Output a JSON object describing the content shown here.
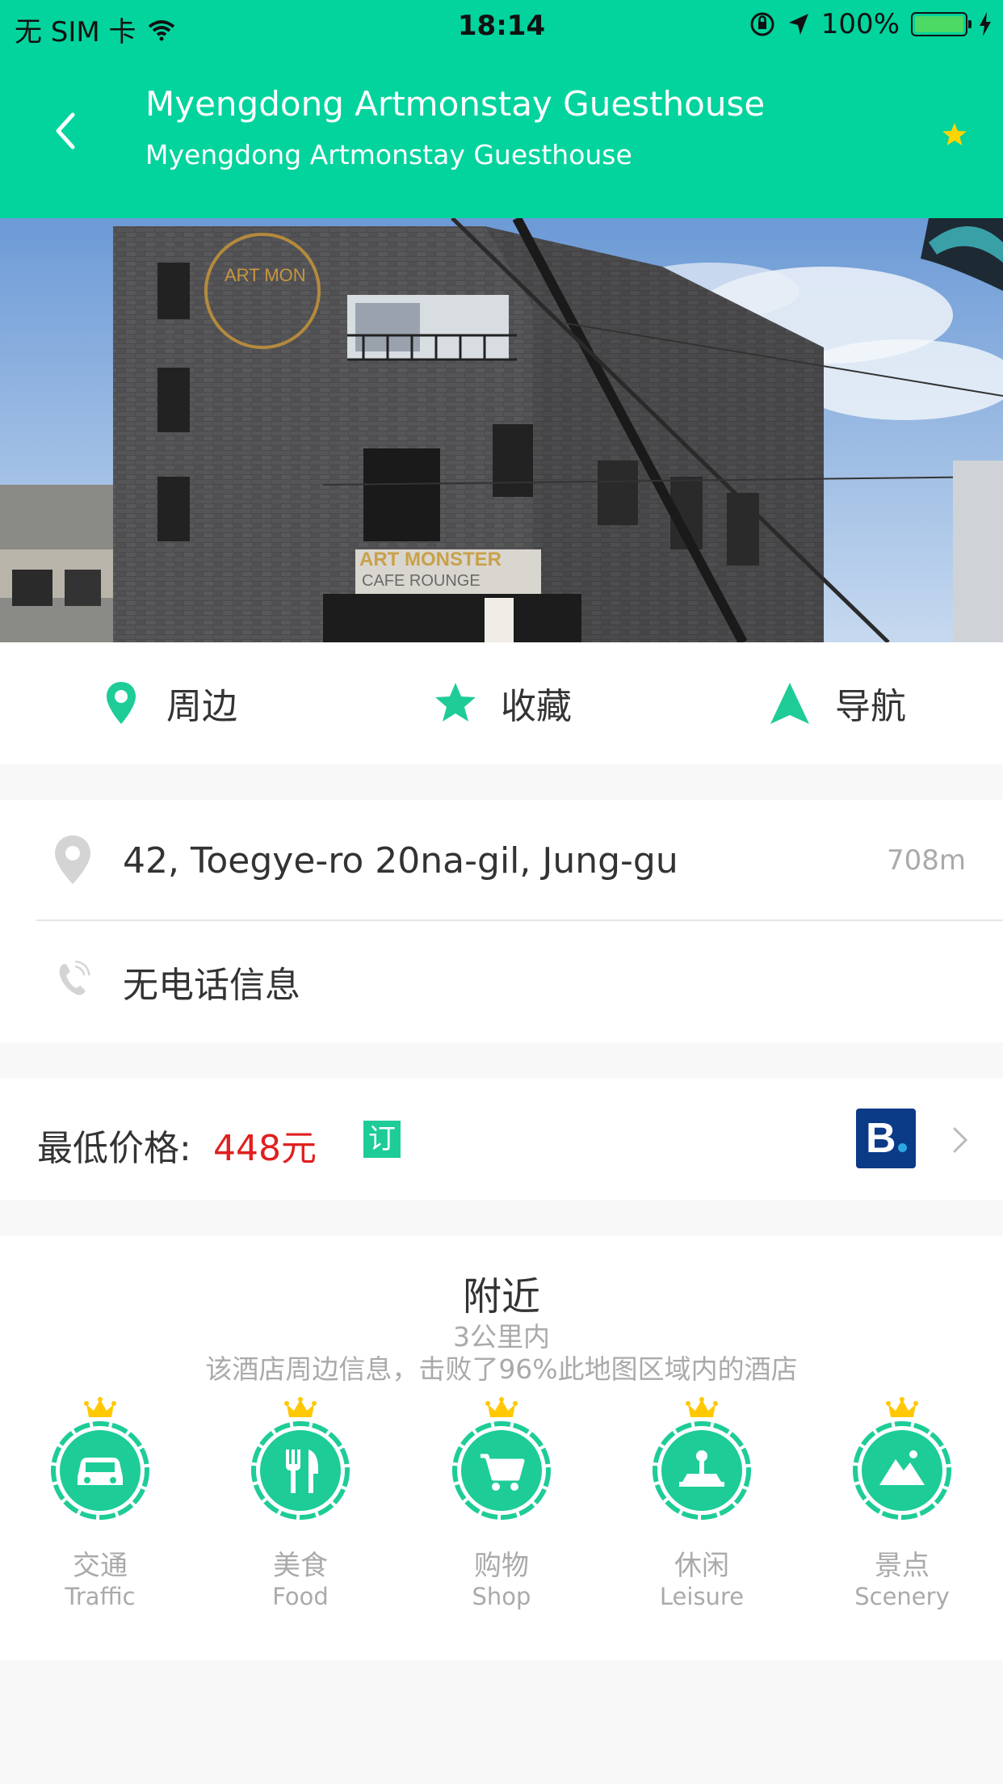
{
  "status_bar": {
    "carrier": "无 SIM 卡",
    "time": "18:14",
    "battery": "100%"
  },
  "header": {
    "title": "Myengdong Artmonstay Guesthouse",
    "subtitle": "Myengdong Artmonstay Guesthouse",
    "accent_color": "#03d39d",
    "favorite_color": "#ffd400"
  },
  "hero": {
    "sign_top": "ART MONSTER",
    "sign_bottom": "CAFE ROUNGE",
    "logo_text": "ART MON"
  },
  "actions": [
    {
      "label": "周边",
      "icon": "location-pin-icon"
    },
    {
      "label": "收藏",
      "icon": "star-icon"
    },
    {
      "label": "导航",
      "icon": "navigation-arrow-icon"
    }
  ],
  "info": {
    "address": "42, Toegye-ro 20na-gil, Jung-gu",
    "distance": "708m",
    "phone": "无电话信息"
  },
  "price": {
    "label": "最低价格:",
    "value": "448元",
    "book_label": "订",
    "provider_logo": "B."
  },
  "nearby": {
    "title": "附近",
    "radius": "3公里内",
    "description": "该酒店周边信息，击败了96%此地图区域内的酒店",
    "categories": [
      {
        "cn": "交通",
        "en": "Traffic",
        "icon": "car-icon"
      },
      {
        "cn": "美食",
        "en": "Food",
        "icon": "fork-knife-icon"
      },
      {
        "cn": "购物",
        "en": "Shop",
        "icon": "cart-icon"
      },
      {
        "cn": "休闲",
        "en": "Leisure",
        "icon": "joystick-icon"
      },
      {
        "cn": "景点",
        "en": "Scenery",
        "icon": "mountain-icon"
      }
    ]
  }
}
